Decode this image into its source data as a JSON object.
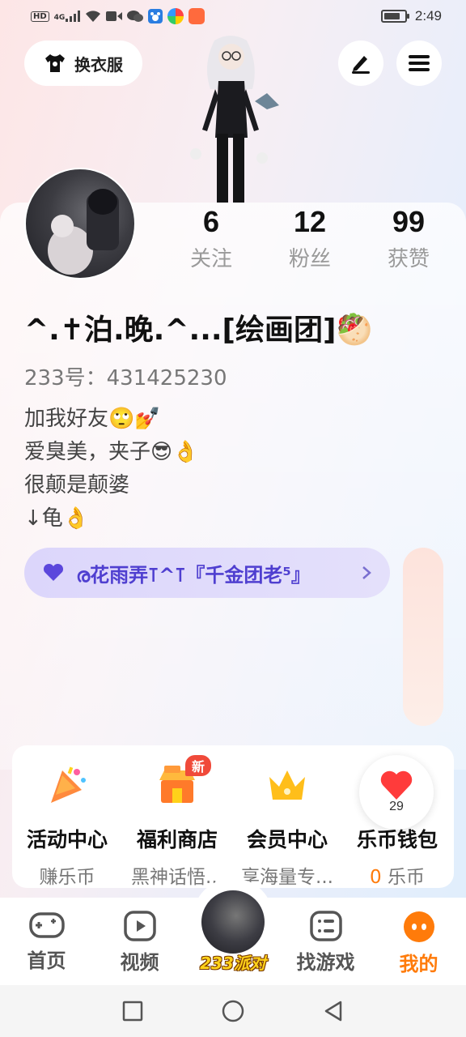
{
  "status": {
    "left_icons": [
      "hd-icon",
      "4g-signal-icon",
      "wifi-icon",
      "video-icon",
      "wechat-icon",
      "paw-icon",
      "app-icon-1",
      "app-icon-2"
    ],
    "network": "4G",
    "time": "2:49"
  },
  "header": {
    "dress_up_label": "换衣服",
    "edit_icon": "pen-icon",
    "menu_icon": "menu-icon"
  },
  "profile": {
    "stats": [
      {
        "num": "6",
        "label": "关注"
      },
      {
        "num": "12",
        "label": "粉丝"
      },
      {
        "num": "99",
        "label": "获赞"
      }
    ],
    "nickname": "^.✝泊.晚.^...[绘画团]🥙",
    "uid": "233号：431425230",
    "bio_lines": [
      "加我好友🙄💅",
      "爱臭美，夹子😎👌",
      "很颠是颠婆",
      "↓龟👌"
    ],
    "guild_text": "ര花雨弄⊺^⊺『千金团老⁵』"
  },
  "functions": [
    {
      "title": "活动中心",
      "sub": "赚乐币",
      "icon": "party-popper-icon"
    },
    {
      "title": "福利商店",
      "sub": "黑神话悟...",
      "icon": "shop-icon",
      "badge": "新"
    },
    {
      "title": "会员中心",
      "sub": "享海量专...",
      "icon": "crown-icon"
    },
    {
      "title": "乐币钱包",
      "sub_num": "0",
      "sub": " 乐币",
      "icon": "wallet-icon"
    }
  ],
  "heart_widget": {
    "count": "29"
  },
  "tabs": [
    {
      "label": "首页",
      "icon": "gamepad-icon"
    },
    {
      "label": "视频",
      "icon": "play-icon"
    },
    {
      "label": "233派对",
      "icon": "party-avatar"
    },
    {
      "label": "找游戏",
      "icon": "list-icon"
    },
    {
      "label": "我的",
      "icon": "face-icon"
    }
  ],
  "colors": {
    "accent": "#ff7b0a",
    "guild": "#4f3fd0",
    "badge": "#f04a3a"
  }
}
